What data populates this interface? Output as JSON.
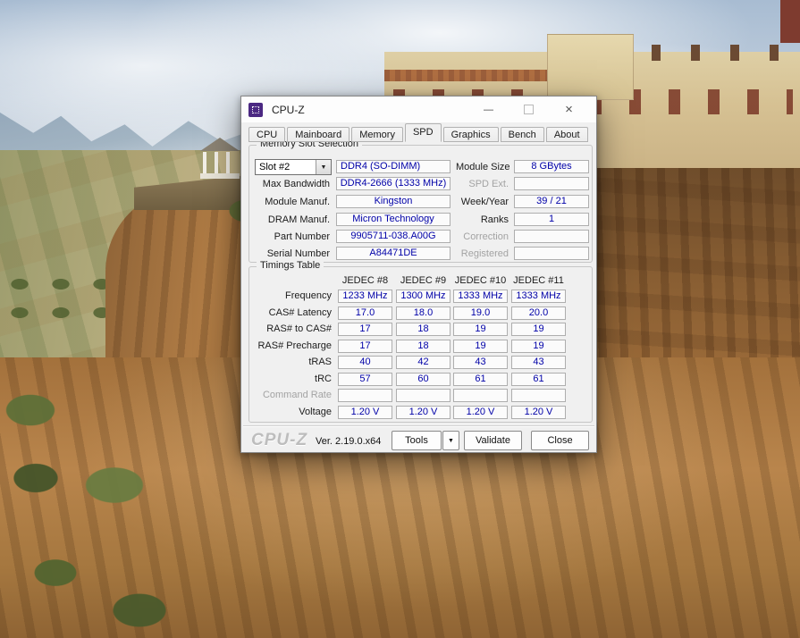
{
  "window": {
    "title": "CPU-Z",
    "icons": {
      "minimize": "—",
      "close": "×",
      "dropdown": "▼"
    },
    "tabs": [
      {
        "label": "CPU"
      },
      {
        "label": "Mainboard"
      },
      {
        "label": "Memory"
      },
      {
        "label": "SPD"
      },
      {
        "label": "Graphics"
      },
      {
        "label": "Bench"
      },
      {
        "label": "About"
      }
    ],
    "active_tab": "SPD"
  },
  "slot_section": {
    "group_label": "Memory Slot Selection",
    "slot_selected": "Slot #2",
    "module_type": "DDR4 (SO-DIMM)",
    "left_rows": [
      {
        "label": "Max Bandwidth",
        "value": "DDR4-2666 (1333 MHz)"
      },
      {
        "label": "Module Manuf.",
        "value": "Kingston"
      },
      {
        "label": "DRAM Manuf.",
        "value": "Micron Technology"
      },
      {
        "label": "Part Number",
        "value": "9905711-038.A00G"
      },
      {
        "label": "Serial Number",
        "value": "A84471DE"
      }
    ],
    "right_rows": [
      {
        "label": "Module Size",
        "value": "8 GBytes"
      },
      {
        "label": "SPD Ext.",
        "value": ""
      },
      {
        "label": "Week/Year",
        "value": "39 / 21"
      },
      {
        "label": "Ranks",
        "value": "1"
      },
      {
        "label": "Correction",
        "value": ""
      },
      {
        "label": "Registered",
        "value": ""
      }
    ]
  },
  "timings": {
    "group_label": "Timings Table",
    "columns": [
      "JEDEC #8",
      "JEDEC #9",
      "JEDEC #10",
      "JEDEC #11"
    ],
    "rows": [
      {
        "label": "Frequency",
        "values": [
          "1233 MHz",
          "1300 MHz",
          "1333 MHz",
          "1333 MHz"
        ]
      },
      {
        "label": "CAS# Latency",
        "values": [
          "17.0",
          "18.0",
          "19.0",
          "20.0"
        ]
      },
      {
        "label": "RAS# to CAS#",
        "values": [
          "17",
          "18",
          "19",
          "19"
        ]
      },
      {
        "label": "RAS# Precharge",
        "values": [
          "17",
          "18",
          "19",
          "19"
        ]
      },
      {
        "label": "tRAS",
        "values": [
          "40",
          "42",
          "43",
          "43"
        ]
      },
      {
        "label": "tRC",
        "values": [
          "57",
          "60",
          "61",
          "61"
        ]
      },
      {
        "label": "Command Rate",
        "values": [
          "",
          "",
          "",
          ""
        ]
      },
      {
        "label": "Voltage",
        "values": [
          "1.20 V",
          "1.20 V",
          "1.20 V",
          "1.20 V"
        ]
      }
    ]
  },
  "footer": {
    "logo": "CPU-Z",
    "version": "Ver. 2.19.0.x64",
    "tools_label": "Tools",
    "validate_label": "Validate",
    "close_label": "Close"
  },
  "colors": {
    "value_text": "#0000A8",
    "dialog_bg": "#F0F0F0",
    "icon_purple": "#4B2882"
  }
}
